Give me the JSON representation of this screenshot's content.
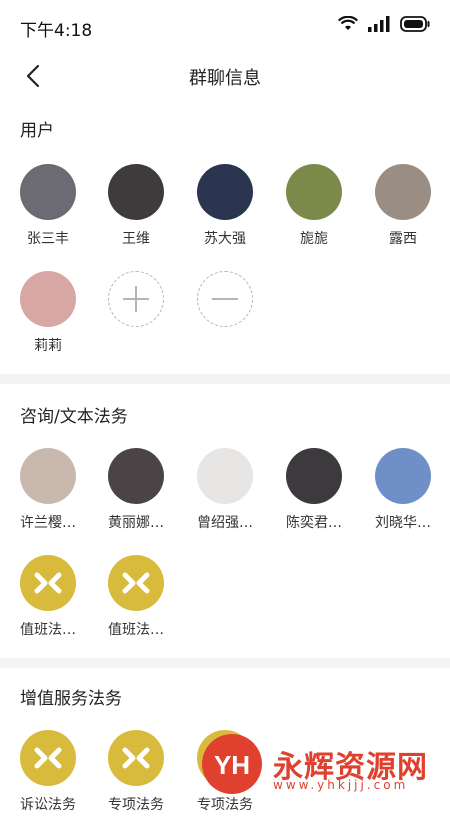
{
  "status_bar": {
    "time": "下午4:18"
  },
  "header": {
    "title": "群聊信息"
  },
  "sections": {
    "users": {
      "title": "用户",
      "members": [
        {
          "name": "张三丰",
          "color": "#6c6a72"
        },
        {
          "name": "王维",
          "color": "#3f3a3c"
        },
        {
          "name": "苏大强",
          "color": "#2c3550"
        },
        {
          "name": "旎旎",
          "color": "#7b8a4a"
        },
        {
          "name": "露西",
          "color": "#9a8d83"
        },
        {
          "name": "莉莉",
          "color": "#d9a7a3"
        }
      ]
    },
    "consult": {
      "title": "咨询/文本法务",
      "members": [
        {
          "name": "许兰樱…",
          "color": "#c9b8ad"
        },
        {
          "name": "黄丽娜…",
          "color": "#4a4446"
        },
        {
          "name": "曾绍强…",
          "color": "#e8e6e4"
        },
        {
          "name": "陈奕君…",
          "color": "#3d3a3d"
        },
        {
          "name": "刘晓华…",
          "color": "#6e8fc7"
        },
        {
          "name": "值班法…",
          "color": "#d8ba3c",
          "logo": true
        },
        {
          "name": "值班法…",
          "color": "#d8ba3c",
          "logo": true
        }
      ]
    },
    "value_added": {
      "title": "增值服务法务",
      "members": [
        {
          "name": "诉讼法务",
          "color": "#d8ba3c",
          "logo": true
        },
        {
          "name": "专项法务",
          "color": "#d8ba3c",
          "logo": true
        },
        {
          "name": "专项法务",
          "color": "#d8ba3c",
          "logo": true
        }
      ]
    }
  },
  "watermark": {
    "brand": "永辉资源网",
    "url": "www.yhkjjj.com",
    "logo_text": "YH"
  }
}
